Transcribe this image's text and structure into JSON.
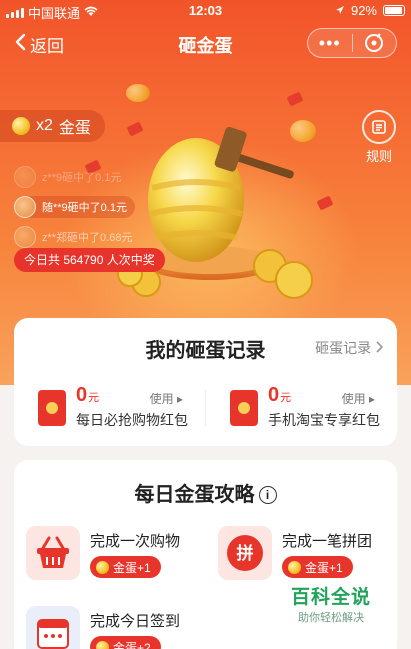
{
  "status_bar": {
    "carrier": "中国联通",
    "time": "12:03",
    "battery": "92%"
  },
  "nav": {
    "back_label": "返回",
    "title": "砸金蛋",
    "more_label": "•••"
  },
  "egg_count": {
    "multiplier": "x2",
    "label": "金蛋"
  },
  "rules_label": "规则",
  "winners": [
    {
      "text": "z**9砸中了0.1元"
    },
    {
      "text": "随**9砸中了0.1元"
    },
    {
      "text": "z**郑砸中了0.68元"
    }
  ],
  "total_winners": "今日共 564790 人次中奖",
  "records": {
    "title": "我的砸蛋记录",
    "link": "砸蛋记录",
    "items": [
      {
        "amount": "0",
        "unit": "元",
        "use": "使用",
        "name": "每日必抢购物红包"
      },
      {
        "amount": "0",
        "unit": "元",
        "use": "使用",
        "name": "手机淘宝专享红包"
      }
    ]
  },
  "strategy": {
    "title": "每日金蛋攻略",
    "info": "i",
    "tasks": [
      {
        "name": "完成一次购物",
        "reward": "金蛋+1",
        "icon": "basket-icon"
      },
      {
        "name": "完成一笔拼团",
        "reward": "金蛋+1",
        "icon": "pin-group-icon",
        "icon_text": "拼"
      },
      {
        "name": "完成今日签到",
        "reward": "金蛋+2",
        "icon": "calendar-icon"
      }
    ]
  },
  "watermark": {
    "title": "百科全说",
    "subtitle": "助你轻松解决"
  },
  "colors": {
    "accent_red": "#e8352c",
    "hero_orange": "#f56a33",
    "gold": "#f5c026"
  }
}
